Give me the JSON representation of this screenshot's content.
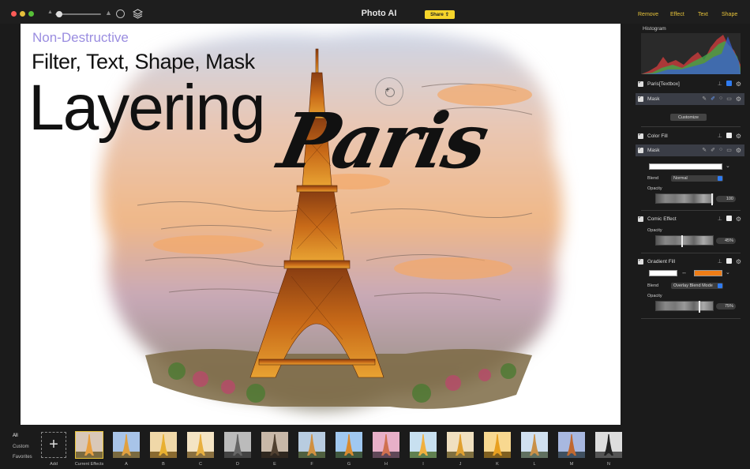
{
  "window": {
    "title": "Photo AI",
    "share_label": "Share"
  },
  "top_tabs": [
    "Remove",
    "Effect",
    "Text",
    "Shape"
  ],
  "canvas": {
    "subheading": "Non-Destructive",
    "heading": "Filter, Text, Shape, Mask",
    "big_heading": "Layering",
    "script_text": "Paris"
  },
  "panel": {
    "histogram_title": "Histogram",
    "layers": [
      {
        "name": "Paris[Textbox]"
      },
      {
        "name": "Mask"
      },
      {
        "name": "Color Fill"
      },
      {
        "name": "Mask"
      },
      {
        "name": "Comic Effect"
      },
      {
        "name": "Gradient Fill"
      }
    ],
    "customize_label": "Customize",
    "color_fill": {
      "color": "#ffffff",
      "blend_label": "Blend",
      "blend_value": "Normal",
      "opacity_label": "Opacity",
      "opacity_value": "100"
    },
    "comic_effect": {
      "opacity_label": "Opacity",
      "opacity_value": "45%",
      "opacity_fraction": 0.45
    },
    "gradient_fill": {
      "color_start": "#ffffff",
      "color_end": "#ef7d16",
      "blend_label": "Blend",
      "blend_value": "Overlay Blend Mode",
      "opacity_label": "Opacity",
      "opacity_value": "75%",
      "opacity_fraction": 0.75
    }
  },
  "bottom": {
    "categories": [
      "All",
      "Custom",
      "Favorites"
    ],
    "add_label": "Add",
    "thumbnails": [
      "Current Effects",
      "A",
      "B",
      "C",
      "D",
      "E",
      "F",
      "G",
      "H",
      "I",
      "J",
      "K",
      "L",
      "M",
      "N"
    ]
  },
  "colors": {
    "accent": "#e8c43a",
    "share_bg": "#f6d52b",
    "subheading": "#9a8de0",
    "toggle_blue": "#2f7bf0"
  }
}
